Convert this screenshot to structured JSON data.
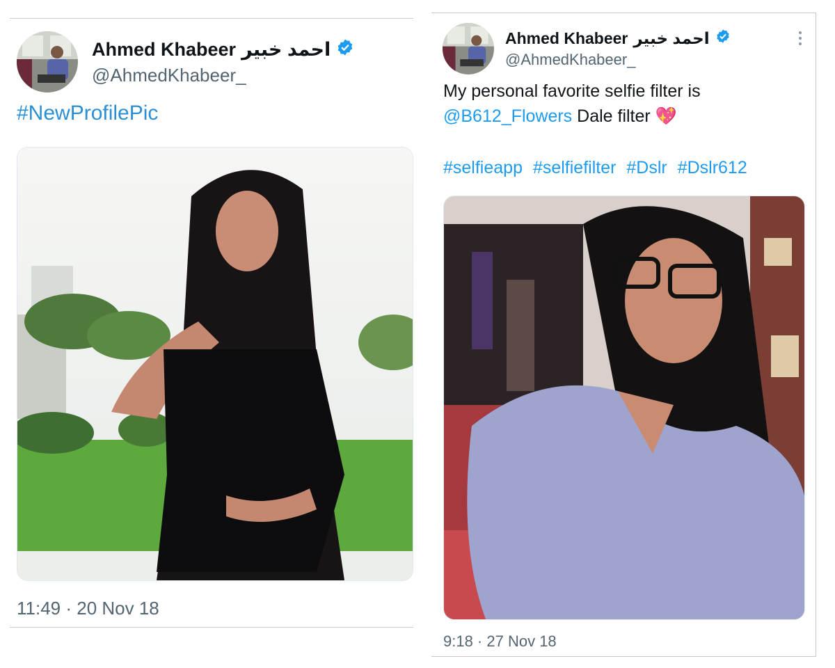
{
  "tweets": [
    {
      "name": "Ahmed Khabeer",
      "name_arabic": "احمد خبير",
      "handle": "@AhmedKhabeer_",
      "hashtag": "#NewProfilePic",
      "timestamp": "11:49 · 20 Nov 18"
    },
    {
      "name": "Ahmed Khabeer",
      "name_arabic": "احمد خبير",
      "handle": "@AhmedKhabeer_",
      "text_line1": "My personal favorite selfie filter is",
      "mention": "@B612_Flowers",
      "text_after_mention": " Dale filter 💖",
      "hashtags": [
        "#selfieapp",
        "#selfiefilter",
        "#Dslr",
        "#Dslr612"
      ],
      "timestamp": "9:18 · 27 Nov 18"
    }
  ],
  "icons": {
    "verified": "verified-badge-icon",
    "more": "more-options-icon"
  },
  "colors": {
    "link": "#1d9bf0",
    "secondary_text": "#536471",
    "verified": "#1d9bf0"
  }
}
